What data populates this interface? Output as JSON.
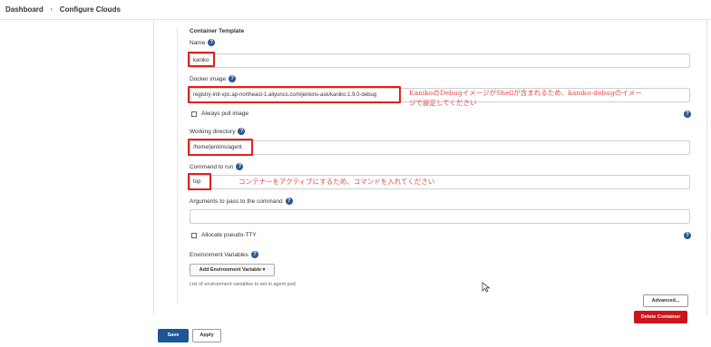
{
  "breadcrumb": {
    "items": [
      "Dashboard",
      "Configure Clouds"
    ],
    "separator": "›"
  },
  "container_template": {
    "section_title": "Container Template",
    "name": {
      "label": "Name",
      "value": "kaniko"
    },
    "docker_image": {
      "label": "Docker image",
      "value": "registry-intl-vpc.ap-northeast-1.aliyuncs.com/jenkins-ask/kaniko:1.9.0-debug"
    },
    "always_pull_image": {
      "label": "Always pull image",
      "checked": false
    },
    "working_directory": {
      "label": "Working directory",
      "value": "/home/jenkins/agent"
    },
    "command_to_run": {
      "label": "Command to run",
      "value": "top"
    },
    "arguments": {
      "label": "Arguments to pass to the command",
      "value": ""
    },
    "allocate_tty": {
      "label": "Allocate pseudo-TTY",
      "checked": false
    },
    "env_vars": {
      "label": "Environment Variables",
      "add_button": "Add Environment Variable",
      "hint": "List of environment variables to set in agent pod"
    }
  },
  "annotations": {
    "docker_image_note_line1": "KanikoのDebugイメージがShellが含まれるため、kaniko-debugのイメー",
    "docker_image_note_line2": "ジで設定してください",
    "command_note": "コンテナーをアクティブにするため、コマンドを入れてください"
  },
  "buttons": {
    "advanced": "Advanced...",
    "delete_container": "Delete Container",
    "save": "Save",
    "apply": "Apply"
  },
  "icons": {
    "help": "?",
    "dropdown_caret": "▾"
  },
  "colors": {
    "help_icon": "#2b5797",
    "highlight_box": "#e02020",
    "note_text": "#e04a4a",
    "save_button": "#1d5596",
    "delete_button": "#c9151b"
  }
}
